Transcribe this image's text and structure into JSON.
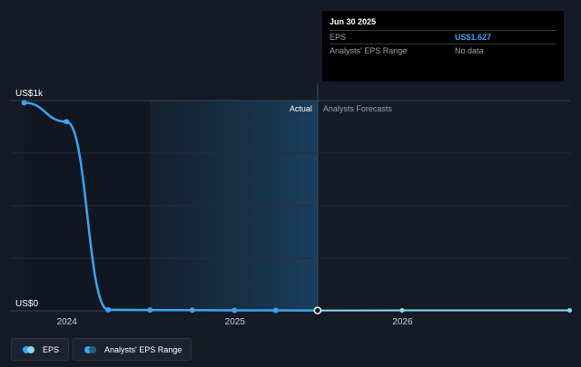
{
  "chart_data": {
    "type": "line",
    "y_axis": {
      "ticks": [
        {
          "value": 0,
          "label": "US$0"
        },
        {
          "value": 1000,
          "label": "US$1k"
        }
      ],
      "ylim": [
        0,
        1000
      ]
    },
    "x_axis": {
      "ticks": [
        {
          "value": "2024-01-01",
          "label": "2024"
        },
        {
          "value": "2025-01-01",
          "label": "2025"
        },
        {
          "value": "2026-01-01",
          "label": "2026"
        }
      ],
      "xlim": [
        "2023-09-01",
        "2027-01-01"
      ]
    },
    "regions": {
      "actual_label": "Actual",
      "forecast_label": "Analysts Forecasts",
      "divider_date": "2025-06-30"
    },
    "series": [
      {
        "name": "EPS",
        "color": "#3ba4ef",
        "points": [
          {
            "x": "2023-09-30",
            "y": 990
          },
          {
            "x": "2023-12-31",
            "y": 900
          },
          {
            "x": "2024-03-31",
            "y": 5
          },
          {
            "x": "2024-06-30",
            "y": 4
          },
          {
            "x": "2024-09-30",
            "y": 3
          },
          {
            "x": "2024-12-31",
            "y": 2
          },
          {
            "x": "2025-03-31",
            "y": 2
          },
          {
            "x": "2025-06-30",
            "y": 1.627
          }
        ]
      },
      {
        "name": "EPS Forecast",
        "color": "#86dcf5",
        "points": [
          {
            "x": "2025-06-30",
            "y": 1.627
          },
          {
            "x": "2025-12-31",
            "y": 1.9
          },
          {
            "x": "2026-12-31",
            "y": 2.2
          }
        ]
      }
    ],
    "grid": true
  },
  "tooltip": {
    "date": "Jun 30 2025",
    "rows": [
      {
        "label": "EPS",
        "value": "US$1.627"
      },
      {
        "label": "Analysts' EPS Range",
        "value": "No data"
      }
    ]
  },
  "legend": {
    "items": [
      {
        "label": "EPS",
        "colors": [
          "#3ba4ef",
          "#86dcf5"
        ]
      },
      {
        "label": "Analysts' EPS Range",
        "colors": [
          "#3ba4ef",
          "#2e5f80"
        ]
      }
    ]
  }
}
